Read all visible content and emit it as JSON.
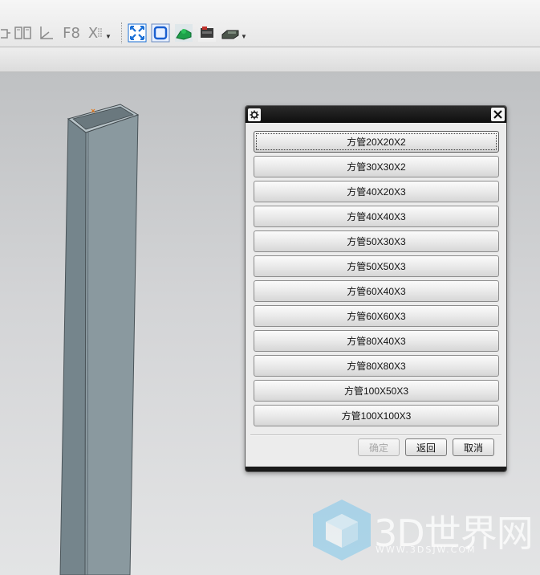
{
  "toolbar": {
    "left_tools": [
      {
        "icon": "layer-copy-icon"
      },
      {
        "icon": "views-icon"
      },
      {
        "icon": "wcs-icon"
      },
      {
        "icon": "snap-view-icon",
        "text": "F8"
      },
      {
        "icon": "show-hide-icon",
        "text": "X"
      }
    ],
    "right_tools": [
      {
        "icon": "fit-view-icon",
        "color": "#1a6fd6"
      },
      {
        "icon": "rounded-square-icon",
        "color": "#1a6fd6"
      },
      {
        "icon": "green-part-icon",
        "color": "#1fa04a"
      },
      {
        "icon": "assembly-block-icon",
        "color": "#c0302a"
      },
      {
        "icon": "machine-part-icon",
        "color": "#3b4a3b"
      }
    ]
  },
  "dialog": {
    "items": [
      {
        "label": "方管20X20X2",
        "focused": true
      },
      {
        "label": "方管30X30X2"
      },
      {
        "label": "方管40X20X3"
      },
      {
        "label": "方管40X40X3"
      },
      {
        "label": "方管50X30X3"
      },
      {
        "label": "方管50X50X3"
      },
      {
        "label": "方管60X40X3"
      },
      {
        "label": "方管60X60X3"
      },
      {
        "label": "方管80X40X3"
      },
      {
        "label": "方管80X80X3"
      },
      {
        "label": "方管100X50X3"
      },
      {
        "label": "方管100X100X3"
      }
    ],
    "ok_label": "确定",
    "back_label": "返回",
    "cancel_label": "取消",
    "ok_disabled": true
  },
  "watermark": {
    "brand": "3D世界网",
    "url": "WWW.3DSJW.COM"
  },
  "colors": {
    "titlebar": "#0e0e0e",
    "viewport_top": "#bfc1c3",
    "tube_front": "#7b8a91",
    "tube_side": "#8a989f"
  }
}
